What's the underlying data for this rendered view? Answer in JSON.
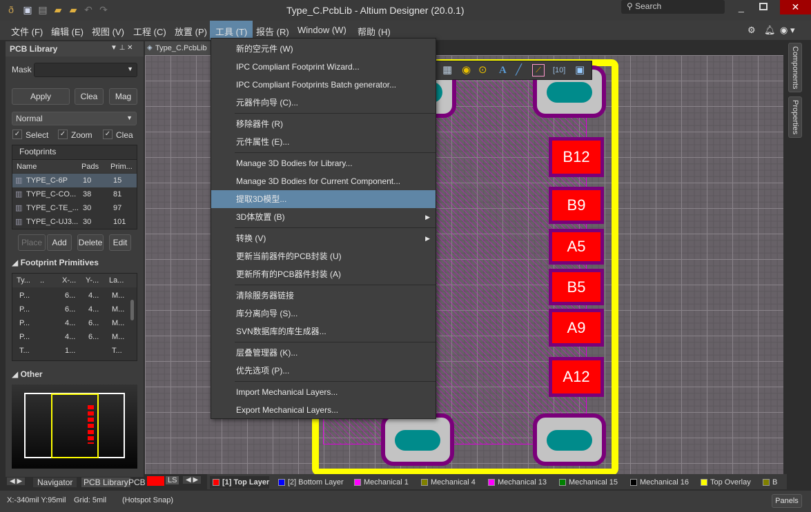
{
  "window": {
    "title": "Type_C.PcbLib - Altium Designer (20.0.1)",
    "search_placeholder": "Search"
  },
  "menubar": [
    "文件 (F)",
    "编辑 (E)",
    "视图 (V)",
    "工程 (C)",
    "放置 (P)",
    "工具 (T)",
    "报告 (R)",
    "Window (W)",
    "帮助 (H)"
  ],
  "panel": {
    "title": "PCB Library",
    "mask_label": "Mask",
    "mask_value": "",
    "apply": "Apply",
    "clear": "Clea",
    "magnify": "Mag",
    "mode": "Normal",
    "checks": [
      {
        "label": "Select",
        "checked": true
      },
      {
        "label": "Zoom",
        "checked": true
      },
      {
        "label": "Clea",
        "checked": true
      }
    ],
    "footprints_header": "Footprints",
    "columns": [
      "Name",
      "Pads",
      "Prim..."
    ],
    "footprints": [
      {
        "name": "TYPE_C-6P",
        "pads": "10",
        "prims": "15"
      },
      {
        "name": "TYPE_C-CO...",
        "pads": "38",
        "prims": "81"
      },
      {
        "name": "TYPE_C-TE_...",
        "pads": "30",
        "prims": "97"
      },
      {
        "name": "TYPE_C-UJ3...",
        "pads": "30",
        "prims": "101"
      }
    ],
    "place": "Place",
    "add": "Add",
    "delete": "Delete",
    "edit": "Edit",
    "primitives_header": "Footprint Primitives",
    "prim_columns": [
      "Ty...",
      "..",
      "X-...",
      "Y-...",
      "La..."
    ],
    "primitives": [
      [
        "P...",
        "",
        "6...",
        "4...",
        "M..."
      ],
      [
        "P...",
        "",
        "6...",
        "4...",
        "M..."
      ],
      [
        "P...",
        "",
        "4...",
        "6...",
        "M..."
      ],
      [
        "P...",
        "",
        "4...",
        "6...",
        "M..."
      ],
      [
        "T...",
        "",
        "1...",
        "",
        "T..."
      ]
    ],
    "other_header": "Other"
  },
  "bottom_tabs": [
    "Navigator",
    "PCB Library",
    "PCB"
  ],
  "document_tab": "Type_C.PcbLib",
  "right_tabs": [
    "Components",
    "Properties"
  ],
  "pads": [
    "B12",
    "B9",
    "A5",
    "B5",
    "A9",
    "A12"
  ],
  "tools_menu": [
    {
      "label": "新的空元件 (W)"
    },
    {
      "label": "IPC Compliant Footprint Wizard..."
    },
    {
      "label": "IPC Compliant Footprints Batch generator..."
    },
    {
      "label": "元器件向导 (C)...",
      "sep": true
    },
    {
      "label": "移除器件 (R)"
    },
    {
      "label": "元件属性 (E)...",
      "sep": true
    },
    {
      "label": "Manage 3D Bodies for Library..."
    },
    {
      "label": "Manage 3D Bodies for Current Component..."
    },
    {
      "label": "提取3D模型...",
      "highlighted": true
    },
    {
      "label": "3D体放置 (B)",
      "submenu": true,
      "sep": true
    },
    {
      "label": "转换 (V)",
      "submenu": true
    },
    {
      "label": "更新当前器件的PCB封装 (U)"
    },
    {
      "label": "更新所有的PCB器件封装 (A)",
      "sep": true
    },
    {
      "label": "清除服务器链接"
    },
    {
      "label": "库分离向导 (S)..."
    },
    {
      "label": "SVN数据库的库生成器...",
      "sep": true
    },
    {
      "label": "层叠管理器 (K)..."
    },
    {
      "label": "优先选项 (P)...",
      "sep": true
    },
    {
      "label": "Import Mechanical Layers..."
    },
    {
      "label": "Export Mechanical Layers..."
    }
  ],
  "layers": [
    {
      "name": "[1] Top Layer",
      "color": "#ff0000",
      "active": true
    },
    {
      "name": "[2] Bottom Layer",
      "color": "#0000ff"
    },
    {
      "name": "Mechanical 1",
      "color": "#ff00ff"
    },
    {
      "name": "Mechanical 4",
      "color": "#808000"
    },
    {
      "name": "Mechanical 13",
      "color": "#ff00ff"
    },
    {
      "name": "Mechanical 15",
      "color": "#008000"
    },
    {
      "name": "Mechanical 16",
      "color": "#000000"
    },
    {
      "name": "Top Overlay",
      "color": "#ffff00"
    },
    {
      "name": "B",
      "color": "#808000"
    }
  ],
  "layer_set": "LS",
  "status": {
    "coords": "X:-340mil Y:95mil",
    "grid": "Grid: 5mil",
    "snap": "(Hotspot Snap)",
    "panels": "Panels"
  }
}
